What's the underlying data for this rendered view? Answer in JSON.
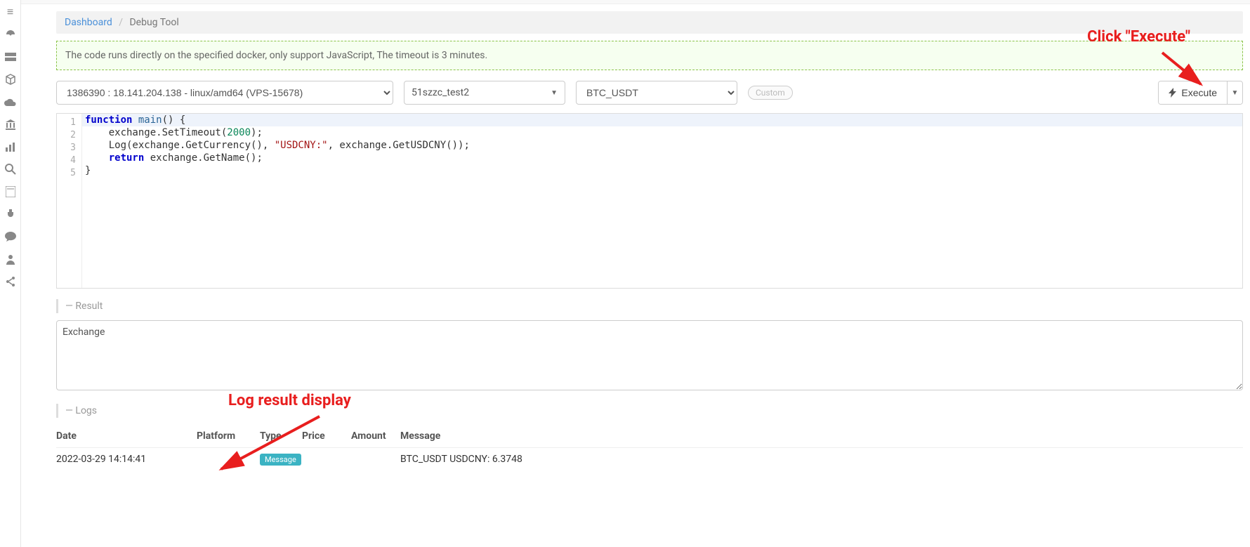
{
  "breadcrumb": {
    "dashboard": "Dashboard",
    "current": "Debug Tool"
  },
  "info": "The code runs directly on the specified docker, only support JavaScript, The timeout is 3 minutes.",
  "toolbar": {
    "docker": "1386390 : 18.141.204.138 - linux/amd64 (VPS-15678)",
    "strategy": "51szzc_test2",
    "symbol": "BTC_USDT",
    "custom": "Custom",
    "execute": "Execute"
  },
  "code": {
    "lines": [
      {
        "n": "1",
        "hl": true
      },
      {
        "n": "2",
        "hl": false
      },
      {
        "n": "3",
        "hl": false
      },
      {
        "n": "4",
        "hl": false
      },
      {
        "n": "5",
        "hl": false
      }
    ],
    "t": {
      "function": "function",
      "main": "main",
      "openp": "() {",
      "l2a": "    exchange.SetTimeout(",
      "l2n": "2000",
      "l2b": ");",
      "l3a": "    Log(exchange.GetCurrency(), ",
      "l3s": "\"USDCNY:\"",
      "l3b": ", exchange.GetUSDCNY());",
      "return": "return",
      "l4b": " exchange.GetName();",
      "l5": "}"
    }
  },
  "result": {
    "label": "— Result",
    "value": "Exchange"
  },
  "logs": {
    "label": "— Logs",
    "headers": {
      "date": "Date",
      "platform": "Platform",
      "type": "Type",
      "price": "Price",
      "amount": "Amount",
      "message": "Message"
    },
    "rows": [
      {
        "date": "2022-03-29 14:14:41",
        "platform": "",
        "type_badge": "Message",
        "price": "",
        "amount": "",
        "message": "BTC_USDT USDCNY: 6.3748"
      }
    ]
  },
  "annot": {
    "click_execute": "Click \"Execute\"",
    "log_result": "Log result display"
  },
  "sidebar_icons": [
    "menu",
    "dashboard",
    "server",
    "cube",
    "cloud",
    "bank",
    "chart",
    "search",
    "calc",
    "plug",
    "chat",
    "user",
    "share"
  ]
}
